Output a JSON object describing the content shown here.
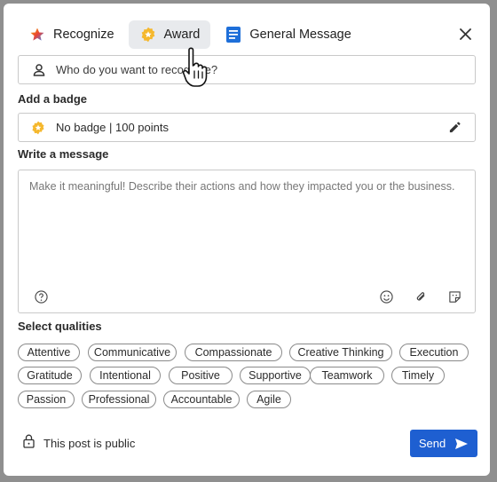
{
  "tabs": [
    {
      "label": "Recognize",
      "icon": "star-icon"
    },
    {
      "label": "Award",
      "icon": "award-badge-icon"
    },
    {
      "label": "General Message",
      "icon": "document-icon"
    }
  ],
  "active_tab": "Award",
  "recipient": {
    "placeholder": "Who do you want to recognize?"
  },
  "badge_section": {
    "label": "Add a badge",
    "value": "No badge | 100 points"
  },
  "message_section": {
    "label": "Write a message",
    "placeholder": "Make it meaningful! Describe their actions and how they impacted you or the business."
  },
  "qualities": {
    "label": "Select qualities",
    "items": [
      "Attentive",
      "Communicative",
      "Compassionate",
      "Creative Thinking",
      "Execution",
      "Gratitude",
      "Intentional",
      "Positive",
      "Supportive",
      "Teamwork",
      "Timely",
      "Passion",
      "Professional",
      "Accountable",
      "Agile"
    ]
  },
  "footer": {
    "privacy_text": "This post is public",
    "send_label": "Send"
  },
  "colors": {
    "primary": "#1e5fd1",
    "badge": "#f5b82e",
    "active_tab_bg": "#e8eaed"
  }
}
